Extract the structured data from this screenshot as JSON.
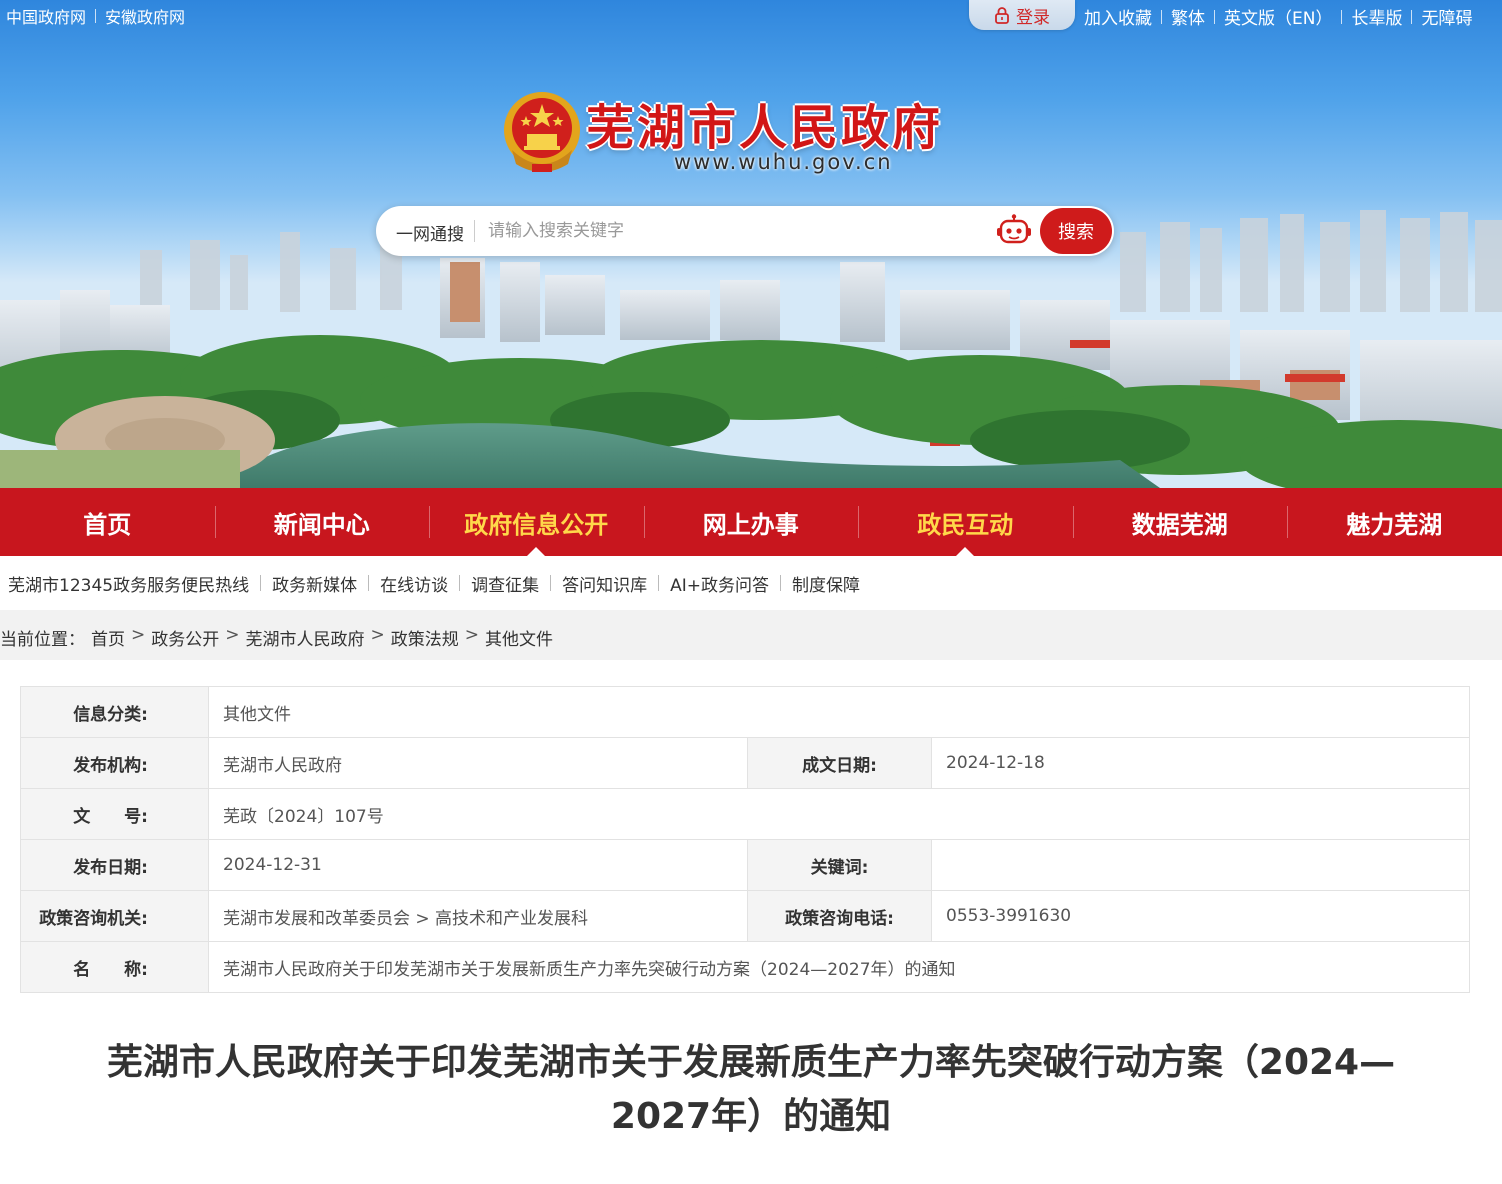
{
  "topbar": {
    "left_links": [
      "中国政府网",
      "安徽政府网"
    ],
    "login_label": "登录",
    "right_links": [
      "加入收藏",
      "繁体",
      "英文版（EN）",
      "长辈版",
      "无障碍"
    ]
  },
  "site": {
    "title": "芜湖市人民政府",
    "url": "www.wuhu.gov.cn"
  },
  "search": {
    "scope_label": "一网通搜",
    "placeholder": "请输入搜索关键字",
    "button_label": "搜索"
  },
  "main_nav": [
    {
      "label": "首页",
      "highlight": false,
      "active": false
    },
    {
      "label": "新闻中心",
      "highlight": false,
      "active": false
    },
    {
      "label": "政府信息公开",
      "highlight": true,
      "active": true
    },
    {
      "label": "网上办事",
      "highlight": false,
      "active": false
    },
    {
      "label": "政民互动",
      "highlight": true,
      "active": true
    },
    {
      "label": "数据芜湖",
      "highlight": false,
      "active": false
    },
    {
      "label": "魅力芜湖",
      "highlight": false,
      "active": false
    }
  ],
  "sub_nav": [
    "芜湖市12345政务服务便民热线",
    "政务新媒体",
    "在线访谈",
    "调查征集",
    "答问知识库",
    "AI+政务问答",
    "制度保障"
  ],
  "breadcrumb": {
    "prefix": "当前位置：",
    "items": [
      "首页",
      "政务公开",
      "芜湖市人民政府",
      "政策法规",
      "其他文件"
    ],
    "separator": ">"
  },
  "meta": {
    "category_label": "信息分类:",
    "category_value": "其他文件",
    "issuer_label": "发布机构:",
    "issuer_value": "芜湖市人民政府",
    "written_date_label": "成文日期:",
    "written_date_value": "2024-12-18",
    "doc_no_label": "文　　号:",
    "doc_no_value": "芜政〔2024〕107号",
    "publish_date_label": "发布日期:",
    "publish_date_value": "2024-12-31",
    "keywords_label": "关键词:",
    "keywords_value": "",
    "consult_org_label": "政策咨询机关:",
    "consult_org_value": "芜湖市发展和改革委员会 > 高技术和产业发展科",
    "consult_phone_label": "政策咨询电话:",
    "consult_phone_value": "0553-3991630",
    "name_label": "名　　称:",
    "name_value": "芜湖市人民政府关于印发芜湖市关于发展新质生产力率先突破行动方案（2024—2027年）的通知"
  },
  "article": {
    "title": "芜湖市人民政府关于印发芜湖市关于发展新质生产力率先突破行动方案（2024—2027年）的通知"
  },
  "colors": {
    "brand_red": "#c8161e",
    "nav_highlight": "#ffd84a",
    "search_button": "#cf1b1b"
  },
  "icons": {
    "login": "lock-icon",
    "assistant": "robot-icon",
    "emblem": "national-emblem-icon"
  }
}
